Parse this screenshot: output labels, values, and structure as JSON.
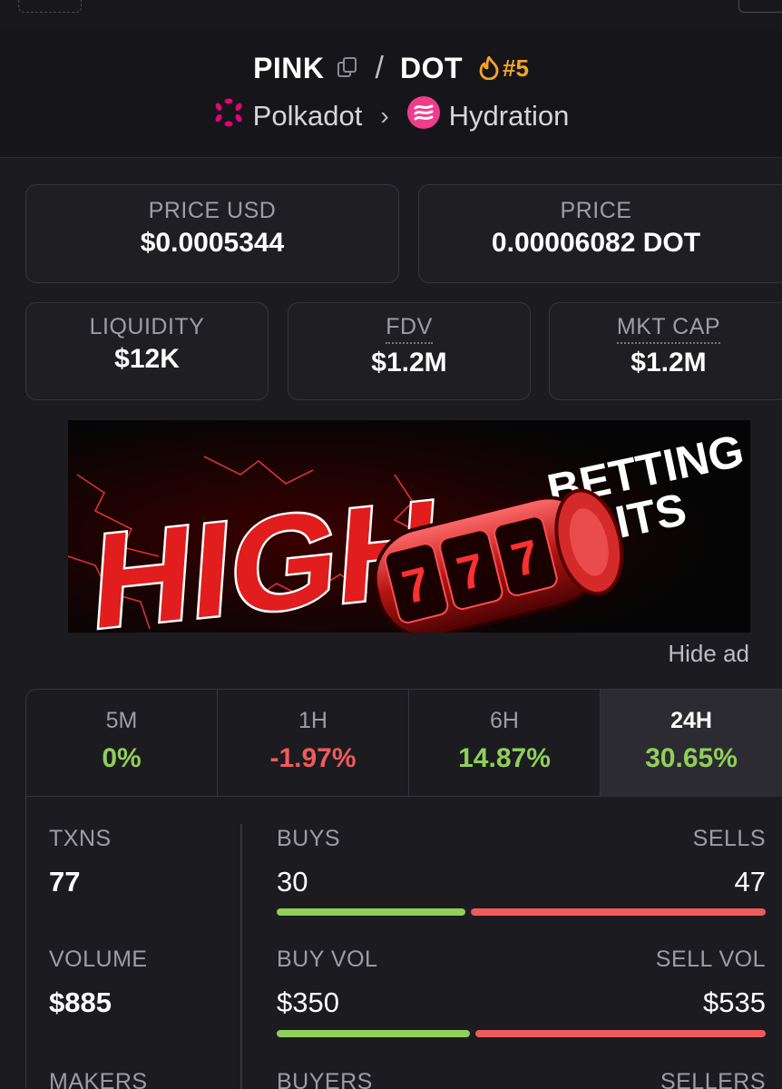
{
  "header": {
    "base_token": "PINK",
    "quote_token": "DOT",
    "separator": "/",
    "rank": "#5",
    "chain": "Polkadot",
    "dex": "Hydration"
  },
  "stats": {
    "price_usd": {
      "label": "PRICE USD",
      "value": "$0.0005344"
    },
    "price": {
      "label": "PRICE",
      "value": "0.00006082 DOT"
    },
    "liquidity": {
      "label": "LIQUIDITY",
      "value": "$12K"
    },
    "fdv": {
      "label": "FDV",
      "value": "$1.2M"
    },
    "mkt_cap": {
      "label": "MKT CAP",
      "value": "$1.2M"
    }
  },
  "ad": {
    "headline": "HIGH",
    "line1": "BETTING",
    "line2": "LIMITS",
    "reel_digit": "7",
    "hide_label": "Hide ad"
  },
  "timeframes": [
    {
      "label": "5M",
      "value": "0%",
      "trend": "up"
    },
    {
      "label": "1H",
      "value": "-1.97%",
      "trend": "down"
    },
    {
      "label": "6H",
      "value": "14.87%",
      "trend": "up"
    },
    {
      "label": "24H",
      "value": "30.65%",
      "trend": "up",
      "active": true
    }
  ],
  "txns": {
    "label": "TXNS",
    "value": "77",
    "buys_label": "BUYS",
    "buys": "30",
    "sells_label": "SELLS",
    "sells": "47",
    "buy_fraction": 0.39
  },
  "volume": {
    "label": "VOLUME",
    "value": "$885",
    "buy_label": "BUY VOL",
    "buy": "$350",
    "sell_label": "SELL VOL",
    "sell": "$535",
    "buy_fraction": 0.4
  },
  "makers": {
    "label": "MAKERS",
    "buyers_label": "BUYERS",
    "sellers_label": "SELLERS"
  },
  "colors": {
    "up": "#8fcf5a",
    "down": "#ef5b5b",
    "rank": "#f5a524",
    "polkadot": "#e6007a",
    "hydration": "#f03c8c"
  }
}
